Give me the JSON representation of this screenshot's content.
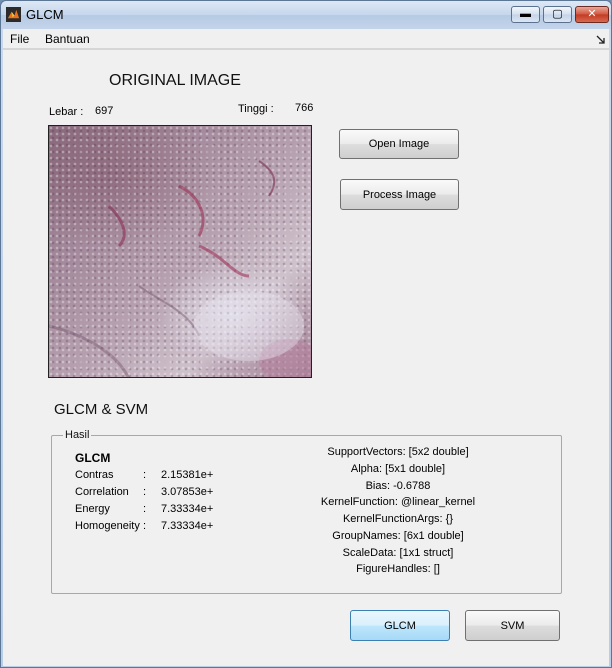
{
  "window": {
    "title": "GLCM",
    "controls": {
      "minimize": "▬",
      "maximize": "▢",
      "close": "✕"
    }
  },
  "menu": {
    "items": [
      "File",
      "Bantuan"
    ],
    "overflow_icon": "arrow-icon"
  },
  "original": {
    "heading": "ORIGINAL IMAGE",
    "width_label": "Lebar :",
    "width_value": "697",
    "height_label": "Tinggi :",
    "height_value": "766"
  },
  "buttons": {
    "open": "Open Image",
    "process": "Process Image",
    "glcm": "GLCM",
    "svm": "SVM"
  },
  "section_heading": "GLCM & SVM",
  "hasil": {
    "legend": "Hasil",
    "glcm_heading": "GLCM",
    "glcm_rows": [
      {
        "name": "Contras",
        "sep": ":",
        "value": "2.15381e+"
      },
      {
        "name": "Correlation",
        "sep": ":",
        "value": "3.07853e+"
      },
      {
        "name": "Energy",
        "sep": ":",
        "value": "7.33334e+"
      },
      {
        "name": "Homogeneity",
        "sep": ":",
        "value": "7.33334e+"
      }
    ],
    "svm_lines": [
      "SupportVectors: [5x2 double]",
      "Alpha: [5x1 double]",
      "Bias: -0.6788",
      "KernelFunction: @linear_kernel",
      "KernelFunctionArgs: {}",
      "GroupNames: [6x1 double]",
      "ScaleData: [1x1 struct]",
      "FigureHandles: []"
    ]
  },
  "colors": {
    "title_bar": "#c5d6ec",
    "panel_bg": "#f0f0f0",
    "close_button": "#c13a22",
    "focused_button": "#bee6fd"
  }
}
